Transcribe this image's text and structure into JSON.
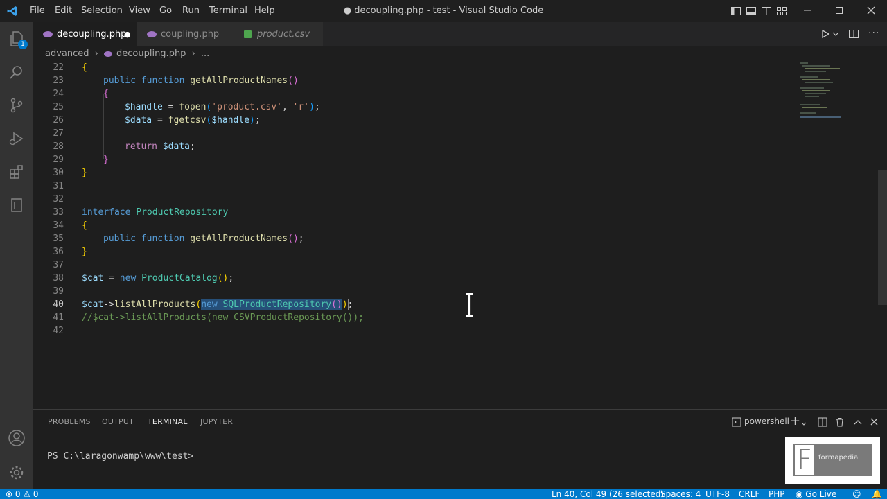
{
  "titlebar": {
    "menu": [
      "File",
      "Edit",
      "Selection",
      "View",
      "Go",
      "Run",
      "Terminal",
      "Help"
    ],
    "title": "● decoupling.php - test - Visual Studio Code"
  },
  "activity": {
    "explorer_badge": "1",
    "icons": [
      "files-icon",
      "search-icon",
      "source-control-icon",
      "run-debug-icon",
      "extensions-icon",
      "remote-explorer-icon"
    ],
    "bottom_icons": [
      "account-icon",
      "settings-gear-icon"
    ]
  },
  "tabs": [
    {
      "label": "decoupling.php",
      "icon": "php",
      "dirty": "●"
    },
    {
      "label": "coupling.php",
      "icon": "php"
    },
    {
      "label": "product.csv",
      "icon": "csv"
    }
  ],
  "breadcrumb": {
    "folder": "advanced",
    "file": "decoupling.php",
    "rest": "..."
  },
  "editor": {
    "line_numbers": [
      "22",
      "23",
      "24",
      "25",
      "26",
      "27",
      "28",
      "29",
      "30",
      "31",
      "32",
      "33",
      "34",
      "35",
      "36",
      "37",
      "38",
      "39",
      "40",
      "41",
      "42"
    ],
    "lines": {
      "l22": "{",
      "l23_a": "public",
      "l23_b": "function",
      "l23_c": "getAllProductNames",
      "l23_d": "()",
      "l24": "{",
      "l25_a": "$handle",
      "l25_b": " = ",
      "l25_c": "fopen",
      "l25_d": "(",
      "l25_e": "'product.csv'",
      "l25_f": ", ",
      "l25_g": "'r'",
      "l25_h": ")",
      "l25_i": ";",
      "l26_a": "$data",
      "l26_b": " = ",
      "l26_c": "fgetcsv",
      "l26_d": "(",
      "l26_e": "$handle",
      "l26_f": ")",
      "l26_g": ";",
      "l28_a": "return",
      "l28_b": " ",
      "l28_c": "$data",
      "l28_d": ";",
      "l29": "}",
      "l30": "}",
      "l33_a": "interface",
      "l33_b": " ",
      "l33_c": "ProductRepository",
      "l34": "{",
      "l35_a": "public",
      "l35_b": "function",
      "l35_c": "getAllProductNames",
      "l35_d": "()",
      "l35_e": ";",
      "l36": "}",
      "l38_a": "$cat",
      "l38_b": " = ",
      "l38_c": "new",
      "l38_d": " ",
      "l38_e": "ProductCatalog",
      "l38_f": "()",
      "l38_g": ";",
      "l40_a": "$cat",
      "l40_b": "->",
      "l40_c": "listAllProducts",
      "l40_d": "(",
      "l40_e": "new",
      "l40_f": " ",
      "l40_g": "SQLProductRepository",
      "l40_h": "()",
      "l40_i": ")",
      "l40_j": ";",
      "l41": "//$cat->listAllProducts(new CSVProductRepository());"
    }
  },
  "panel": {
    "tabs": [
      "PROBLEMS",
      "OUTPUT",
      "TERMINAL",
      "JUPYTER"
    ],
    "active_tab": "TERMINAL",
    "shell": "powershell",
    "prompt": "PS C:\\laragonwamp\\www\\test>"
  },
  "statusbar": {
    "problems": "⊗ 0 ⚠ 0",
    "position": "Ln 40, Col 49 (26 selected)",
    "spaces": "Spaces: 4",
    "encoding": "UTF-8",
    "eol": "CRLF",
    "language": "PHP",
    "golive": "Go Live"
  },
  "watermark": {
    "letter": "F",
    "text": "formapedia"
  },
  "colors": {
    "accent": "#007acc",
    "editor_bg": "#1e1e1e",
    "selection": "#264f78"
  }
}
